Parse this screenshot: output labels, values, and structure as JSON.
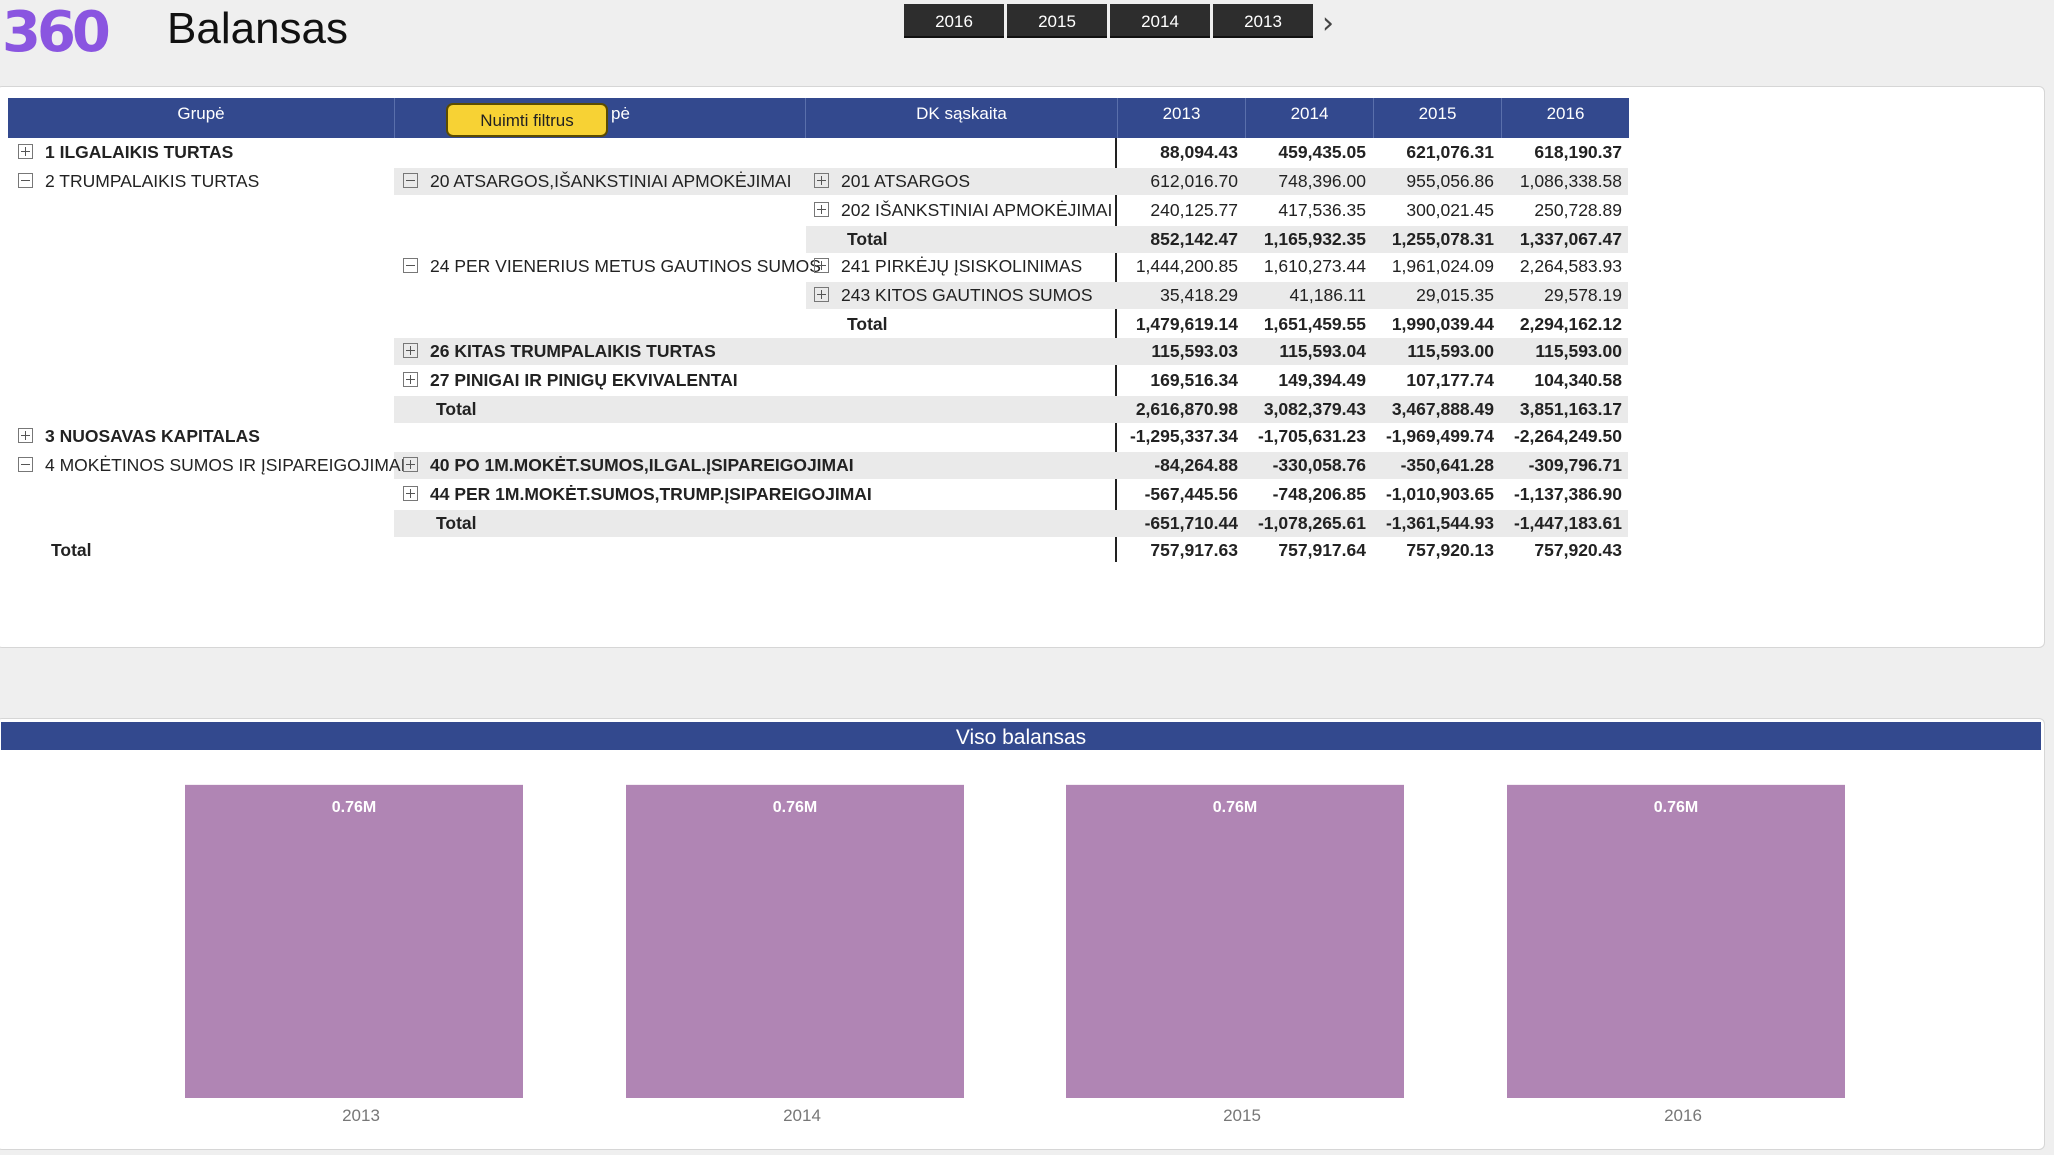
{
  "header": {
    "logo_text": "360",
    "title": "Balansas",
    "year_slicer": [
      "2016",
      "2015",
      "2014",
      "2013"
    ]
  },
  "filter_button": "Nuimti filtrus",
  "matrix": {
    "columns": {
      "group": "Grupė",
      "subgroup": "pė",
      "account": "DK sąskaita",
      "years": [
        "2013",
        "2014",
        "2015",
        "2016"
      ]
    },
    "rows": [
      {
        "level": 1,
        "expander": "plus",
        "label": "1 ILGALAIKIS TURTAS",
        "bold": true,
        "values": [
          "88,094.43",
          "459,435.05",
          "621,076.31",
          "618,190.37"
        ],
        "bold_values": true
      },
      {
        "level": 1,
        "expander": "minus",
        "label": "2 TRUMPALAIKIS TURTAS",
        "sub_expander": "minus",
        "sub_label": "20 ATSARGOS,IŠANKSTINIAI APMOKĖJIMAI",
        "acc_expander": "plus",
        "acc_label": "201 ATSARGOS",
        "values": [
          "612,016.70",
          "748,396.00",
          "955,056.86",
          "1,086,338.58"
        ],
        "shade": true
      },
      {
        "acc_expander": "plus",
        "acc_label": "202 IŠANKSTINIAI APMOKĖJIMAI",
        "values": [
          "240,125.77",
          "417,536.35",
          "300,021.45",
          "250,728.89"
        ]
      },
      {
        "acc_label": "Total",
        "acc_bold": true,
        "values": [
          "852,142.47",
          "1,165,932.35",
          "1,255,078.31",
          "1,337,067.47"
        ],
        "bold_values": true,
        "shade": true
      },
      {
        "sub_expander": "minus",
        "sub_label": "24 PER VIENERIUS METUS GAUTINOS SUMOS",
        "acc_expander": "plus",
        "acc_label": "241 PIRKĖJŲ ĮSISKOLINIMAS",
        "values": [
          "1,444,200.85",
          "1,610,273.44",
          "1,961,024.09",
          "2,264,583.93"
        ]
      },
      {
        "acc_expander": "plus",
        "acc_label": "243 KITOS GAUTINOS SUMOS",
        "values": [
          "35,418.29",
          "41,186.11",
          "29,015.35",
          "29,578.19"
        ],
        "shade": true
      },
      {
        "acc_label": "Total",
        "acc_bold": true,
        "values": [
          "1,479,619.14",
          "1,651,459.55",
          "1,990,039.44",
          "2,294,162.12"
        ],
        "bold_values": true
      },
      {
        "sub_expander": "plus",
        "sub_label": "26 KITAS TRUMPALAIKIS TURTAS",
        "sub_bold": true,
        "values": [
          "115,593.03",
          "115,593.04",
          "115,593.00",
          "115,593.00"
        ],
        "bold_values": true,
        "shade": true
      },
      {
        "sub_expander": "plus",
        "sub_label": "27 PINIGAI IR PINIGŲ EKVIVALENTAI",
        "sub_bold": true,
        "values": [
          "169,516.34",
          "149,394.49",
          "107,177.74",
          "104,340.58"
        ],
        "bold_values": true
      },
      {
        "sub_label": "Total",
        "sub_bold": true,
        "values": [
          "2,616,870.98",
          "3,082,379.43",
          "3,467,888.49",
          "3,851,163.17"
        ],
        "bold_values": true,
        "shade": true
      },
      {
        "level": 1,
        "expander": "plus",
        "label": "3 NUOSAVAS KAPITALAS",
        "bold": true,
        "values": [
          "-1,295,337.34",
          "-1,705,631.23",
          "-1,969,499.74",
          "-2,264,249.50"
        ],
        "bold_values": true
      },
      {
        "level": 1,
        "expander": "minus",
        "label": "4 MOKĖTINOS SUMOS IR ĮSIPAREIGOJIMAI",
        "sub_expander": "plus",
        "sub_label": "40 PO 1M.MOKĖT.SUMOS,ILGAL.ĮSIPAREIGOJIMAI",
        "sub_bold": true,
        "values": [
          "-84,264.88",
          "-330,058.76",
          "-350,641.28",
          "-309,796.71"
        ],
        "bold_values": true,
        "shade": true
      },
      {
        "sub_expander": "plus",
        "sub_label": "44 PER 1M.MOKĖT.SUMOS,TRUMP.ĮSIPAREIGOJIMAI",
        "sub_bold": true,
        "values": [
          "-567,445.56",
          "-748,206.85",
          "-1,010,903.65",
          "-1,137,386.90"
        ],
        "bold_values": true
      },
      {
        "sub_label": "Total",
        "sub_bold": true,
        "values": [
          "-651,710.44",
          "-1,078,265.61",
          "-1,361,544.93",
          "-1,447,183.61"
        ],
        "bold_values": true,
        "shade": true
      },
      {
        "label": "Total",
        "bold": true,
        "total_row": true,
        "values": [
          "757,917.63",
          "757,917.64",
          "757,920.13",
          "757,920.43"
        ],
        "bold_values": true
      }
    ]
  },
  "chart_title": "Viso balansas",
  "chart_data": {
    "type": "bar",
    "title": "Viso balansas",
    "categories": [
      "2013",
      "2014",
      "2015",
      "2016"
    ],
    "values": [
      757917.63,
      757917.64,
      757920.13,
      757920.43
    ],
    "data_labels": [
      "0.76M",
      "0.76M",
      "0.76M",
      "0.76M"
    ],
    "bar_color": "#b085b4",
    "xlabel": "",
    "ylabel": "",
    "ylim": [
      0,
      760000
    ],
    "grid": false
  },
  "colors": {
    "header_blue": "#33498e",
    "filter_yellow": "#f7d234",
    "logo_purple": "#8a55e0"
  }
}
